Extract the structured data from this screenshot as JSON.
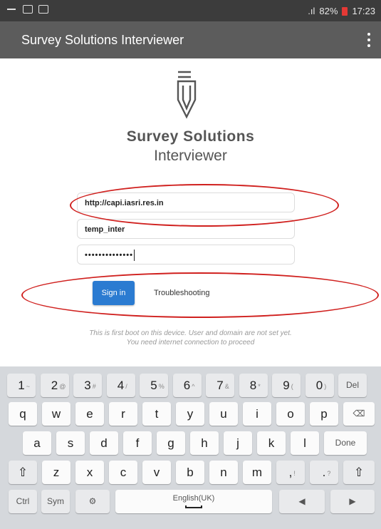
{
  "status_bar": {
    "notifications": "▭ ▣ ◧",
    "indicators": "⛨ ☰",
    "signal": ".ıl",
    "battery": "82%",
    "time": "17:23"
  },
  "app_bar": {
    "title": "Survey Solutions Interviewer"
  },
  "brand": {
    "name": "Survey Solutions",
    "sub": "Interviewer"
  },
  "form": {
    "server_url": "http://capi.iasri.res.in",
    "username": "temp_inter",
    "password_mask": "••••••••••••••"
  },
  "actions": {
    "sign_in": "Sign in",
    "troubleshooting": "Troubleshooting"
  },
  "info": {
    "line1": "This is first boot on this device. User and domain are not set yet.",
    "line2": "You need internet connection to proceed"
  },
  "keyboard": {
    "row1": [
      {
        "k": "1",
        "s": "~"
      },
      {
        "k": "2",
        "s": "@"
      },
      {
        "k": "3",
        "s": "#"
      },
      {
        "k": "4",
        "s": "/"
      },
      {
        "k": "5",
        "s": "%"
      },
      {
        "k": "6",
        "s": "^"
      },
      {
        "k": "7",
        "s": "&"
      },
      {
        "k": "8",
        "s": "*"
      },
      {
        "k": "9",
        "s": "("
      },
      {
        "k": "0",
        "s": ")"
      }
    ],
    "del": "Del",
    "row2": [
      "q",
      "w",
      "e",
      "r",
      "t",
      "y",
      "u",
      "i",
      "o",
      "p"
    ],
    "row3": [
      "a",
      "s",
      "d",
      "f",
      "g",
      "h",
      "j",
      "k",
      "l"
    ],
    "done": "Done",
    "row4": [
      "z",
      "x",
      "c",
      "v",
      "b",
      "n",
      "m"
    ],
    "comma": ",",
    "comma_sub": "!",
    "period": ".",
    "period_sub": "?",
    "ctrl": "Ctrl",
    "sym": "Sym",
    "space": "English(UK)"
  }
}
